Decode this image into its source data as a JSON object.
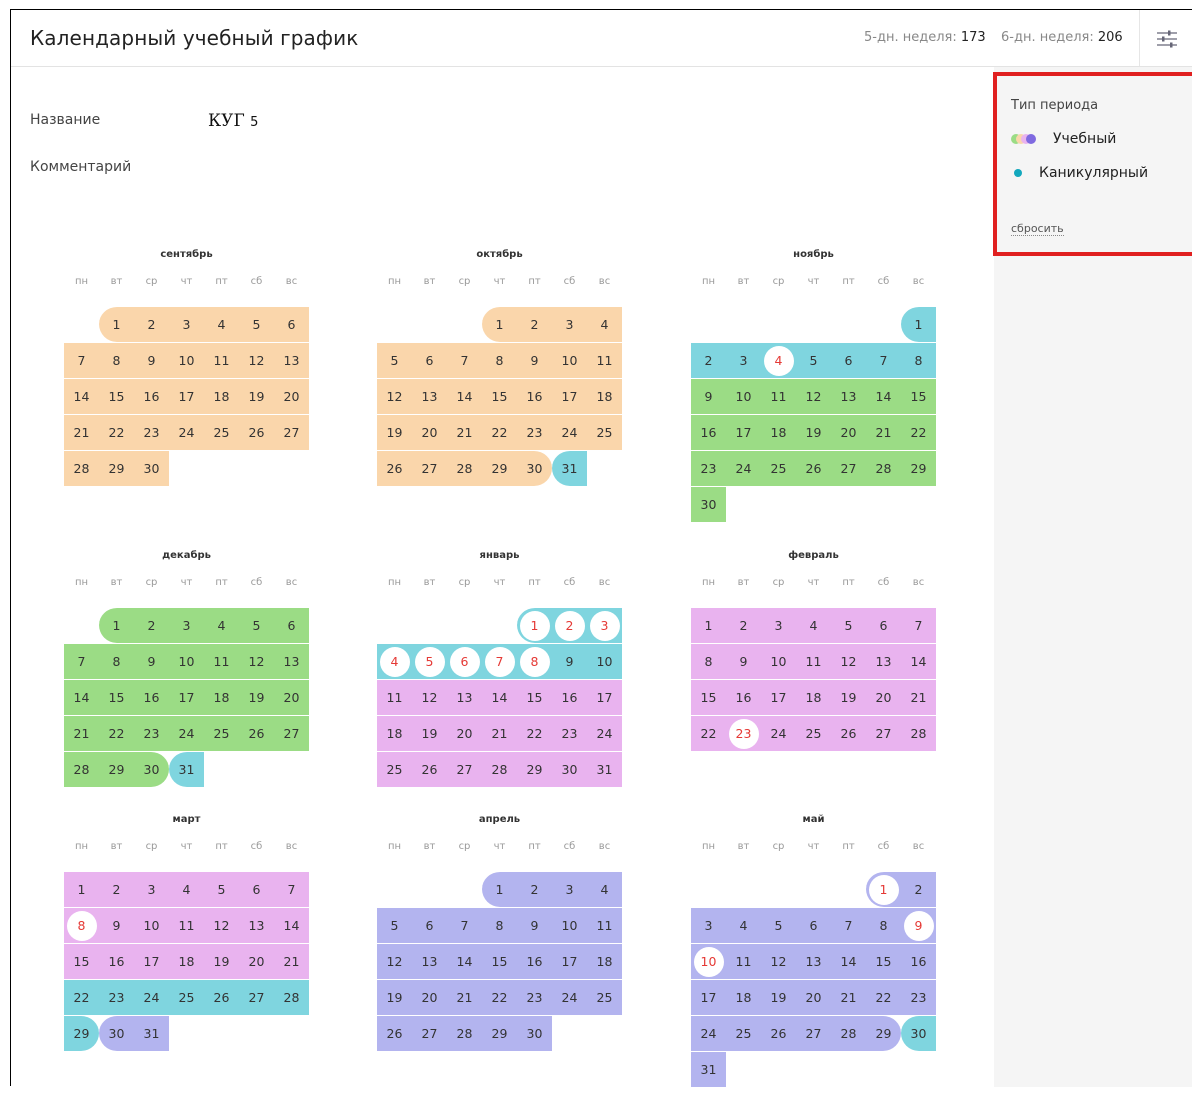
{
  "header": {
    "title": "Календарный учебный график",
    "stats": [
      {
        "label": "5-дн. неделя:",
        "value": "173"
      },
      {
        "label": "6-дн. неделя:",
        "value": "206"
      }
    ],
    "filter_icon": "sliders-icon"
  },
  "info": {
    "name_label": "Название",
    "name_value_main": "КУГ",
    "name_value_num": "5",
    "comment_label": "Комментарий"
  },
  "filter": {
    "title": "Тип периода",
    "items": [
      {
        "label": "Учебный",
        "icon": "multicolor-dots-icon"
      },
      {
        "label": "Каникулярный",
        "icon": "teal-dot-icon"
      }
    ],
    "reset_label": "сбросить"
  },
  "colors": {
    "peach": "#fad6ab",
    "teal": "#7fd5df",
    "green": "#9bdc85",
    "pink": "#e9b3ef",
    "lavender": "#b3b4ef",
    "holiday_text": "#e53935",
    "filter_border": "#e02020",
    "sidebar_bg": "#f5f5f5"
  },
  "weekdays": [
    "пн",
    "вт",
    "ср",
    "чт",
    "пт",
    "сб",
    "вс"
  ],
  "months": [
    {
      "name": "сентябрь",
      "offset": 1,
      "days": 30,
      "segments": [
        [
          1,
          30,
          "peach"
        ]
      ],
      "holidays": []
    },
    {
      "name": "октябрь",
      "offset": 3,
      "days": 31,
      "segments": [
        [
          1,
          30,
          "peach"
        ],
        [
          31,
          31,
          "teal"
        ]
      ],
      "holidays": []
    },
    {
      "name": "ноябрь",
      "offset": 6,
      "days": 30,
      "segments": [
        [
          1,
          8,
          "teal"
        ],
        [
          9,
          30,
          "green"
        ]
      ],
      "holidays": [
        4
      ]
    },
    {
      "name": "декабрь",
      "offset": 1,
      "days": 31,
      "segments": [
        [
          1,
          30,
          "green"
        ],
        [
          31,
          31,
          "teal"
        ]
      ],
      "holidays": []
    },
    {
      "name": "январь",
      "offset": 4,
      "days": 31,
      "segments": [
        [
          1,
          10,
          "teal"
        ],
        [
          11,
          31,
          "pink"
        ]
      ],
      "holidays": [
        1,
        2,
        3,
        4,
        5,
        6,
        7,
        8
      ]
    },
    {
      "name": "февраль",
      "offset": 0,
      "days": 28,
      "segments": [
        [
          1,
          28,
          "pink"
        ]
      ],
      "holidays": [
        23
      ]
    },
    {
      "name": "март",
      "offset": 0,
      "days": 31,
      "segments": [
        [
          1,
          21,
          "pink"
        ],
        [
          22,
          29,
          "teal"
        ],
        [
          30,
          31,
          "lavender"
        ]
      ],
      "holidays": [
        8
      ]
    },
    {
      "name": "апрель",
      "offset": 3,
      "days": 30,
      "segments": [
        [
          1,
          30,
          "lavender"
        ]
      ],
      "holidays": []
    },
    {
      "name": "май",
      "offset": 5,
      "days": 31,
      "segments": [
        [
          1,
          29,
          "lavender"
        ],
        [
          30,
          30,
          "teal"
        ],
        [
          31,
          31,
          "lavender"
        ]
      ],
      "holidays": [
        1,
        9,
        10
      ]
    }
  ]
}
